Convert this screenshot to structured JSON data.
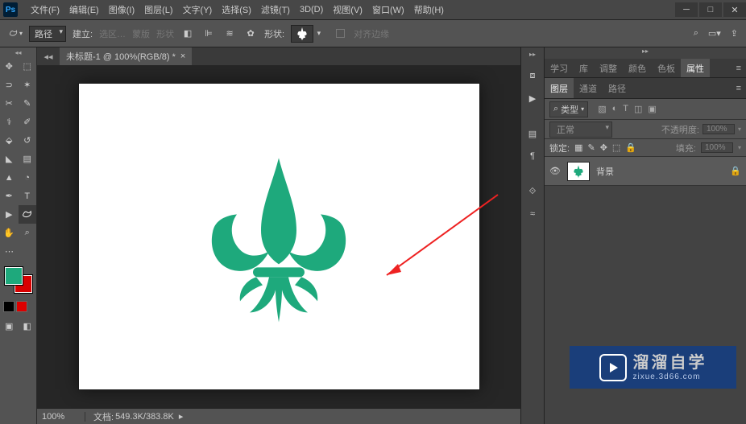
{
  "menubar": {
    "items": [
      "文件(F)",
      "编辑(E)",
      "图像(I)",
      "图层(L)",
      "文字(Y)",
      "选择(S)",
      "滤镜(T)",
      "3D(D)",
      "视图(V)",
      "窗口(W)",
      "帮助(H)"
    ]
  },
  "optbar": {
    "mode": "路径",
    "make_lbl": "建立:",
    "sel_btn": "选区…",
    "mask_btn": "蒙版",
    "shape_btn": "形状",
    "shape_lbl": "形状:",
    "align_lbl": "对齐边缘"
  },
  "document": {
    "tab_title": "未标题-1 @ 100%(RGB/8) *",
    "zoom": "100%",
    "info_lbl": "文档:",
    "info_val": "549.3K/383.8K"
  },
  "panels": {
    "tabs1": [
      "学习",
      "库",
      "调整",
      "颜色",
      "色板",
      "属性"
    ],
    "active1": 5,
    "tabs2": [
      "图层",
      "通道",
      "路径"
    ],
    "active2": 0,
    "kind": "类型",
    "blend": "正常",
    "opacity_lbl": "不透明度:",
    "opacity_val": "100%",
    "lock_lbl": "锁定:",
    "fill_lbl": "填充:",
    "fill_val": "100%",
    "layers": [
      {
        "name": "背景",
        "locked": true
      }
    ]
  },
  "watermark": {
    "main": "溜溜自学",
    "sub": "zixue.3d66.com"
  }
}
